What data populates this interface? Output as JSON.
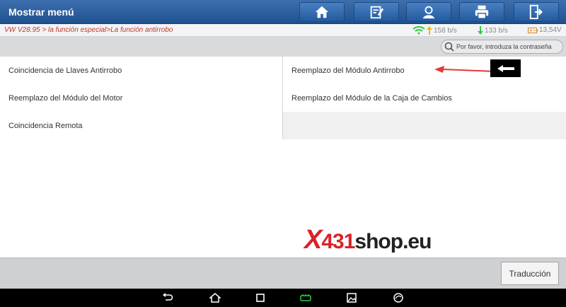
{
  "header": {
    "title": "Mostrar menú",
    "buttons": [
      {
        "name": "home",
        "icon": "home-icon"
      },
      {
        "name": "report",
        "icon": "edit-report-icon"
      },
      {
        "name": "feedback",
        "icon": "user-support-icon"
      },
      {
        "name": "print",
        "icon": "printer-icon"
      },
      {
        "name": "exit",
        "icon": "exit-icon"
      }
    ]
  },
  "status": {
    "breadcrumb": "VW V28.95 > la función especial>La función antirrobo",
    "upload": "158 b/s",
    "download": "133 b/s",
    "voltage": "13,54V"
  },
  "toolbar": {
    "password_prompt": "Por favor, introduza la contraseña"
  },
  "menu": {
    "rows": [
      [
        "Coincidencia de Llaves Antirrobo",
        "Reemplazo del Módulo Antirrobo"
      ],
      [
        "Reemplazo del Módulo del Motor",
        "Reemplazo del Módulo de la Caja de Cambios"
      ],
      [
        "Coincidencia Remota",
        ""
      ]
    ]
  },
  "watermark": {
    "x": "X",
    "num": "431",
    "rest": "shop.eu"
  },
  "footer": {
    "translate_label": "Traducción"
  },
  "colors": {
    "header_blue": "#2a5b9a",
    "breadcrumb_red": "#c0392b",
    "wifi_green": "#2ecc40",
    "watermark_red": "#d8232a"
  }
}
